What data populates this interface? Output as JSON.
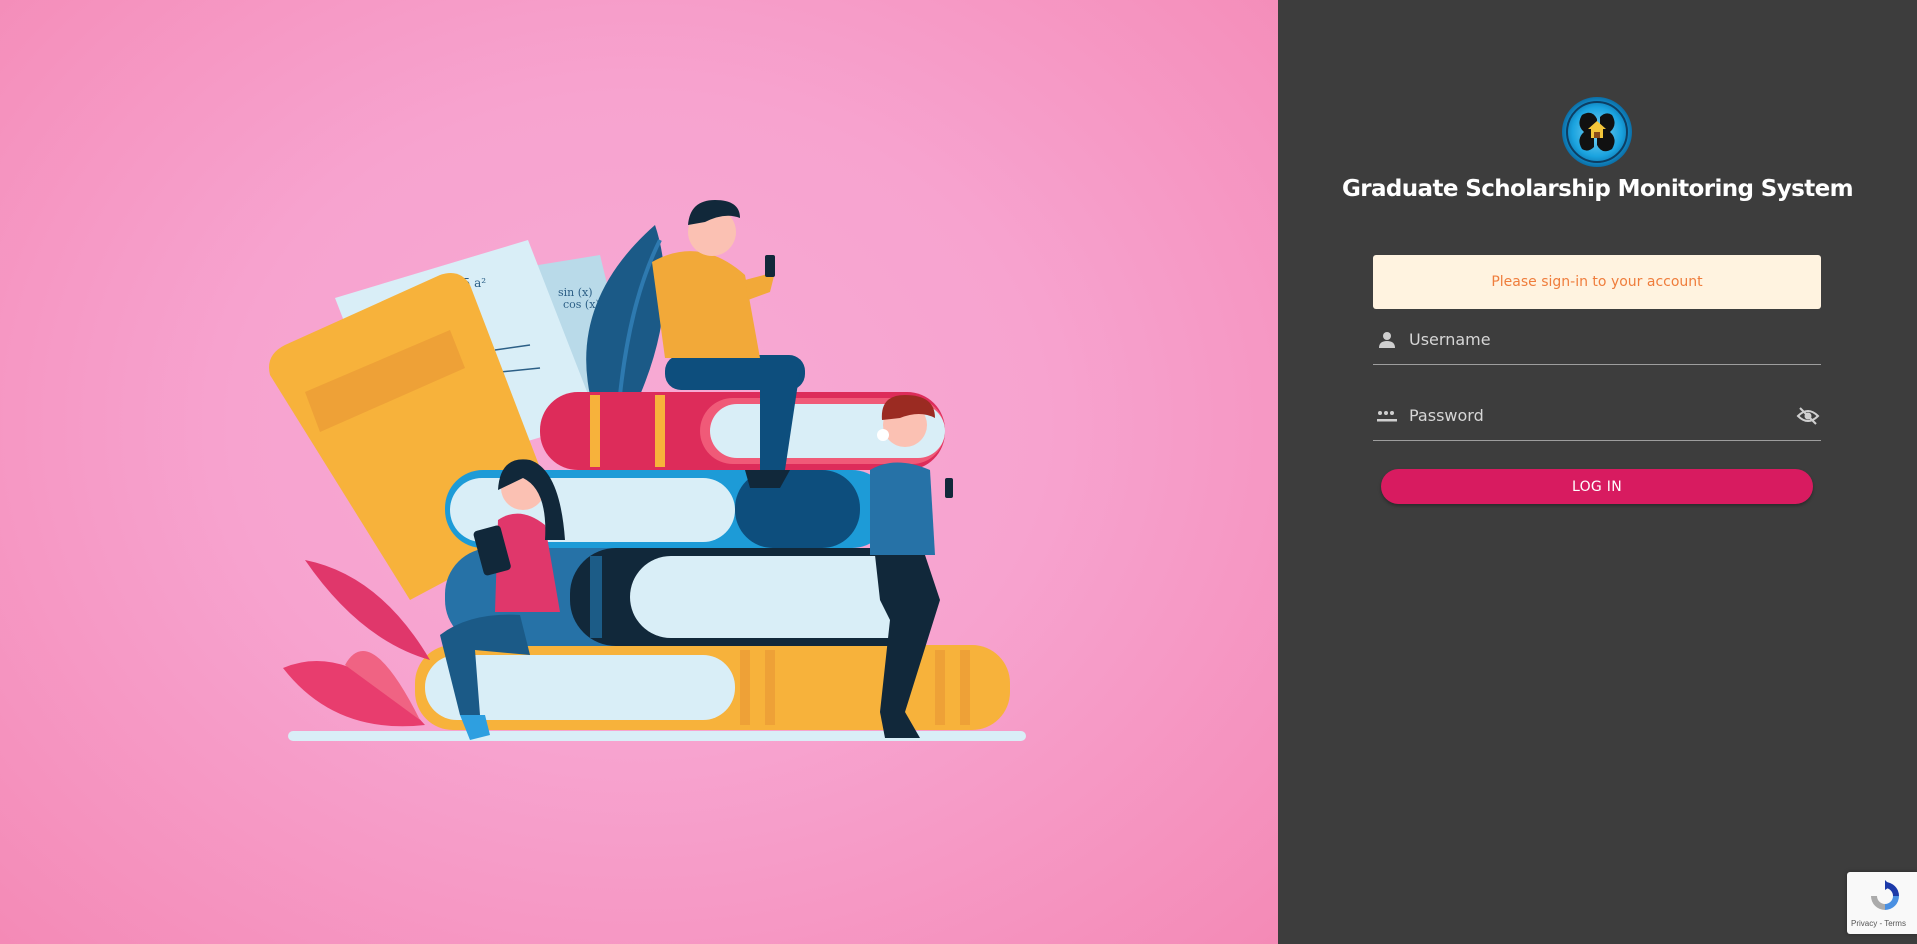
{
  "app": {
    "title": "Graduate Scholarship Monitoring System",
    "logo_icon": "university-seal-icon"
  },
  "login": {
    "alert_text": "Please sign-in to your account",
    "username_placeholder": "Username",
    "username_value": "",
    "password_placeholder": "Password",
    "password_value": "",
    "submit_label": "LOG IN"
  },
  "recaptcha": {
    "text": "Privacy - Terms"
  },
  "colors": {
    "left_bg": "#f7a3cf",
    "right_bg": "#3d3d3d",
    "accent": "#d81b60",
    "alert_bg": "#fff3e0",
    "alert_text": "#ef7d3c"
  },
  "illustration": "students-with-books-illustration"
}
